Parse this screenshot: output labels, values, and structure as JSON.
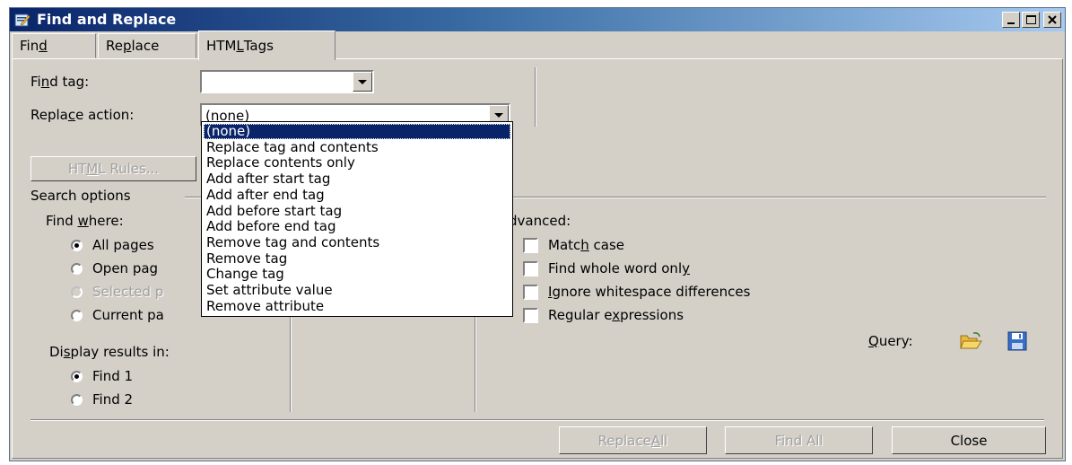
{
  "window": {
    "title": "Find and Replace",
    "minimize_glyph": "_",
    "maximize_glyph": "□",
    "close_glyph": "×"
  },
  "tabs": [
    {
      "pre": "Fin",
      "key": "d",
      "post": ""
    },
    {
      "pre": "Re",
      "key": "p",
      "post": "lace"
    },
    {
      "pre": "HTM",
      "key": "L",
      "post": " Tags"
    }
  ],
  "find_tag": {
    "pre": "Fi",
    "key": "n",
    "post": "d tag:",
    "value": ""
  },
  "replace_action": {
    "pre": "Repla",
    "key": "c",
    "post": "e action:",
    "value": "(none)"
  },
  "html_rules_button": {
    "pre": "HT",
    "key": "M",
    "post": "L Rules..."
  },
  "dropdown_options": [
    "(none)",
    "Replace tag and contents",
    "Replace contents only",
    "Add after start tag",
    "Add after end tag",
    "Add before start tag",
    "Add before end tag",
    "Remove tag and contents",
    "Remove tag",
    "Change tag",
    "Set attribute value",
    "Remove attribute"
  ],
  "search_options": {
    "label": "Search options",
    "find_where": {
      "pre": "Find ",
      "key": "w",
      "post": "here:"
    },
    "radios": [
      {
        "label": "All pages",
        "checked": true,
        "disabled": false
      },
      {
        "label": "Open pag",
        "checked": false,
        "disabled": false
      },
      {
        "label": "Selected p",
        "checked": false,
        "disabled": true
      },
      {
        "label": "Current pa",
        "checked": false,
        "disabled": false
      }
    ],
    "display_results": {
      "pre": "Di",
      "key": "s",
      "post": "play results in:"
    },
    "result_radios": [
      {
        "label": "Find 1",
        "checked": true
      },
      {
        "label": "Find 2",
        "checked": false
      }
    ]
  },
  "advanced": {
    "label": "dvanced:",
    "options": [
      {
        "pre": "Matc",
        "key": "h",
        "post": " case",
        "checked": false
      },
      {
        "pre": "Find whole word onl",
        "key": "y",
        "post": "",
        "checked": false
      },
      {
        "pre": "",
        "key": "I",
        "post": "gnore whitespace differences",
        "checked": false
      },
      {
        "pre": "Regular e",
        "key": "x",
        "post": "pressions",
        "checked": false
      }
    ],
    "query": {
      "pre": "",
      "key": "Q",
      "post": "uery:"
    }
  },
  "buttons": {
    "replace_all": {
      "pre": "Replace ",
      "key": "A",
      "post": "ll"
    },
    "find_all": {
      "pre": "Find All",
      "key": "",
      "post": ""
    },
    "close": "Close"
  },
  "colors": {
    "dialog_bg": "#d4d0c8",
    "title_start": "#0a246a",
    "title_end": "#a6caf0",
    "selection": "#0a246a"
  },
  "icons": {
    "app": "find-replace-app-icon",
    "open_query": "folder-open-icon",
    "save_query": "floppy-save-icon"
  }
}
